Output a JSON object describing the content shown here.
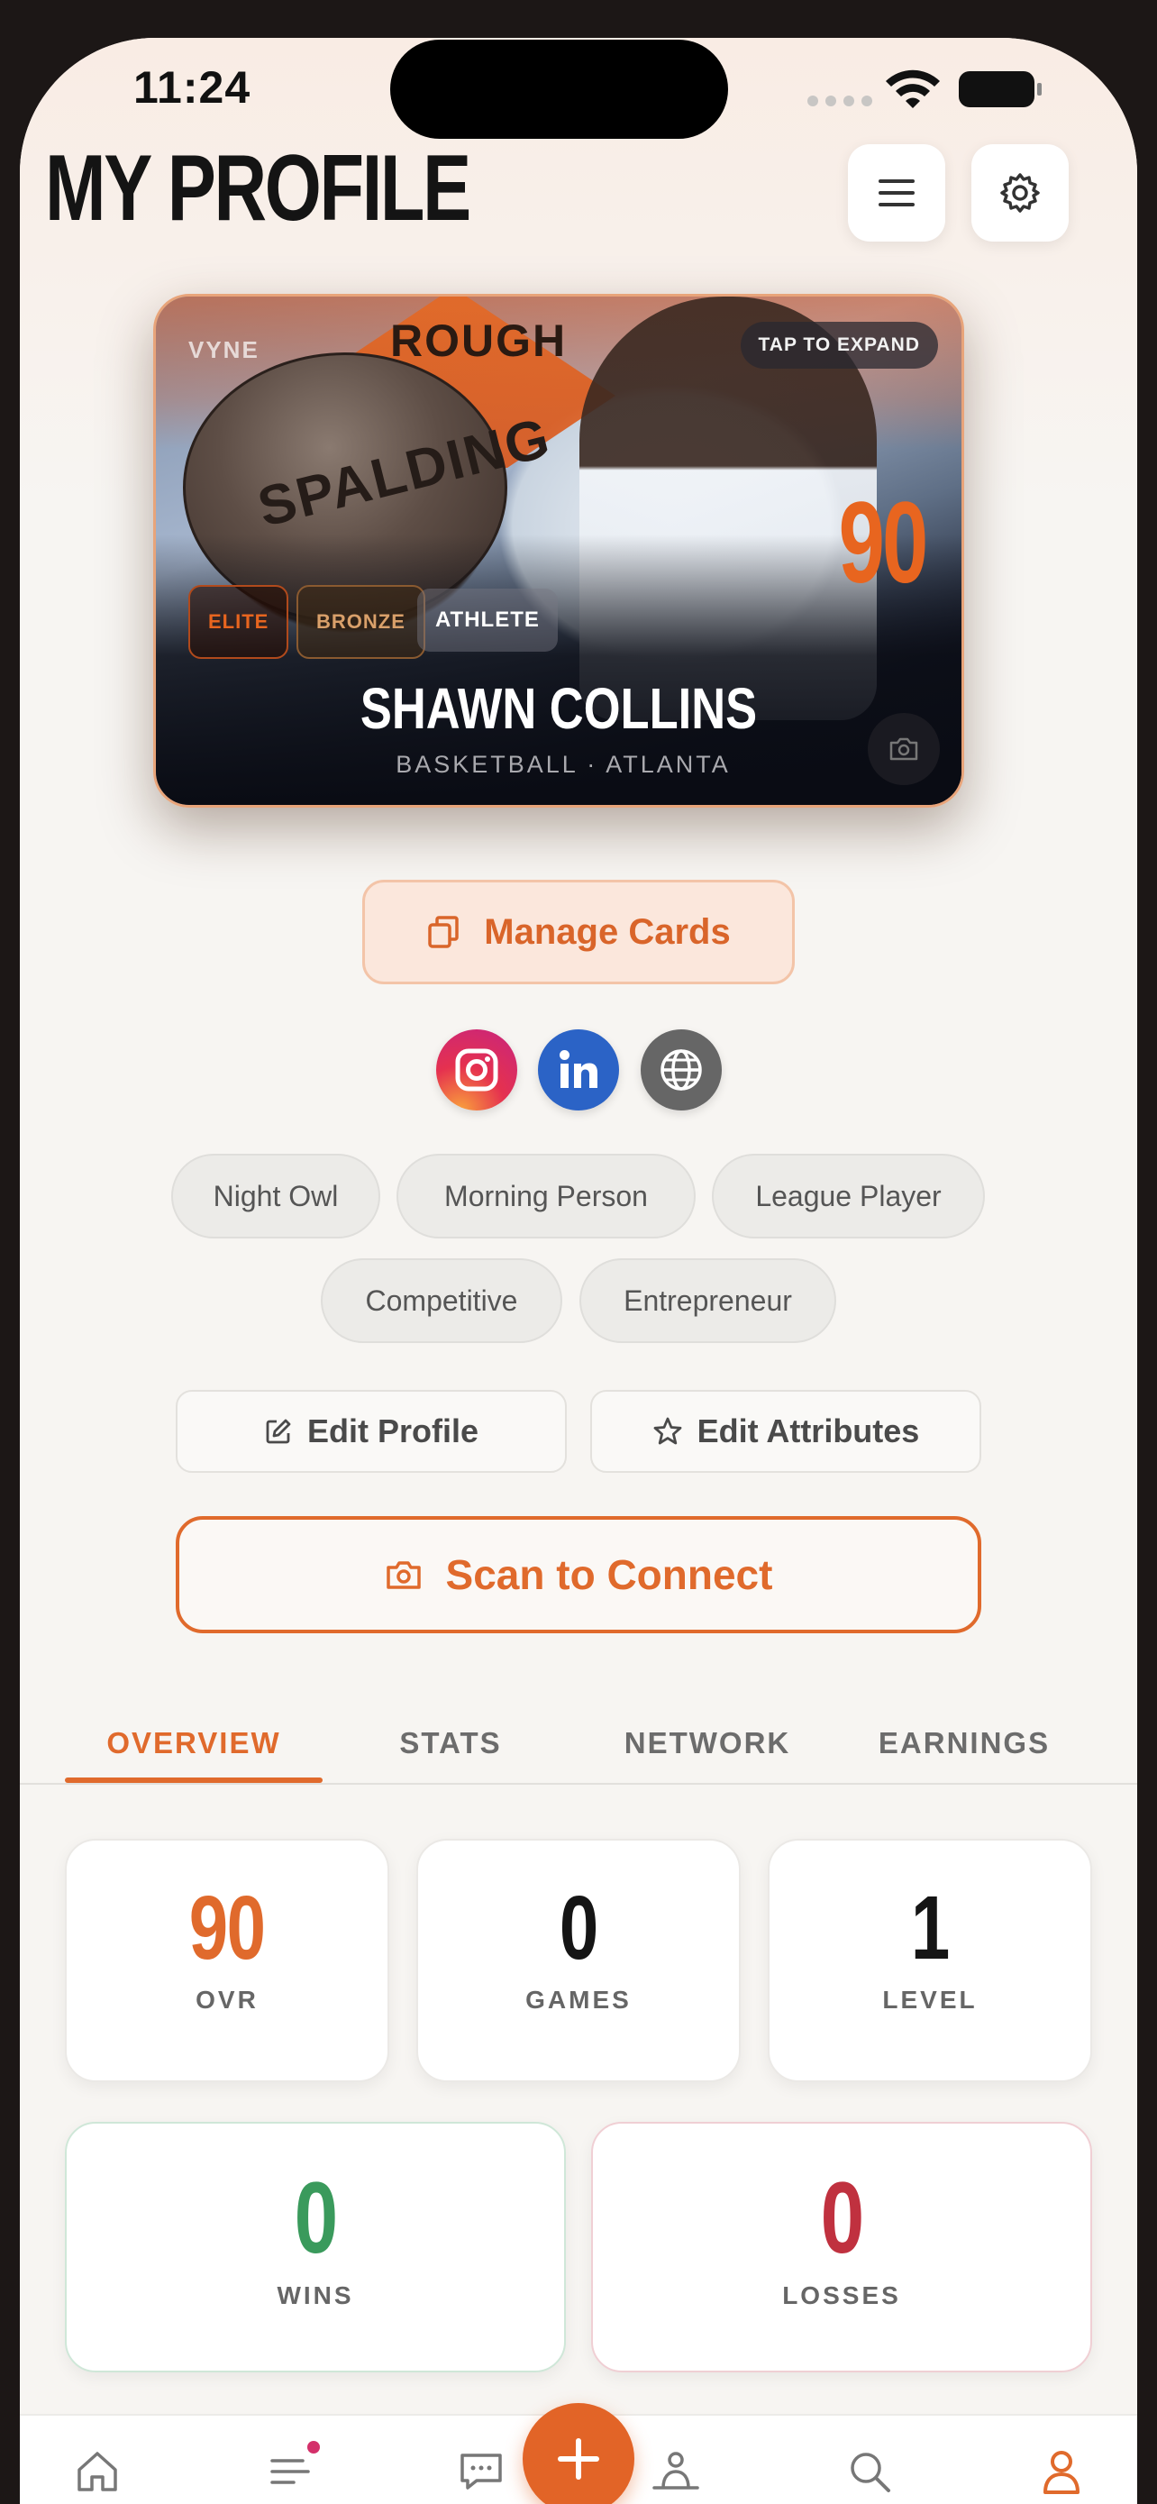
{
  "status_bar": {
    "time": "11:24"
  },
  "header": {
    "title": "MY PROFILE"
  },
  "athlete_card": {
    "brand": "VYNE",
    "tap_hint": "TAP TO EXPAND",
    "overall": "90",
    "badges": [
      "ELITE",
      "BRONZE",
      "ATHLETE"
    ],
    "name": "SHAWN COLLINS",
    "subtitle": "BASKETBALL · ATLANTA",
    "photo_sign_text": "ROUGH",
    "photo_ball_text": "SPALDING",
    "accent_color": "#e8651f"
  },
  "manage_cards": {
    "label": "Manage Cards"
  },
  "socials": [
    "instagram-icon",
    "linkedin-icon",
    "globe-icon"
  ],
  "tags": [
    "Night Owl",
    "Morning Person",
    "League Player",
    "Competitive",
    "Entrepreneur"
  ],
  "actions": {
    "edit_profile": "Edit Profile",
    "edit_attributes": "Edit Attributes",
    "scan": "Scan to Connect"
  },
  "tabs": [
    {
      "label": "OVERVIEW",
      "active": true
    },
    {
      "label": "STATS",
      "active": false
    },
    {
      "label": "NETWORK",
      "active": false
    },
    {
      "label": "EARNINGS",
      "active": false
    }
  ],
  "stats": {
    "ovr": {
      "value": "90",
      "label": "OVR"
    },
    "games": {
      "value": "0",
      "label": "GAMES"
    },
    "level": {
      "value": "1",
      "label": "LEVEL"
    },
    "wins": {
      "value": "0",
      "label": "WINS"
    },
    "losses": {
      "value": "0",
      "label": "LOSSES"
    }
  },
  "bottom_nav": [
    "home-icon",
    "feed-icon",
    "messages-icon",
    "add-icon",
    "network-icon",
    "search-icon",
    "profile-icon"
  ],
  "colors": {
    "accent": "#e06a2c",
    "win": "#3a9a5c",
    "loss": "#c0313f"
  }
}
